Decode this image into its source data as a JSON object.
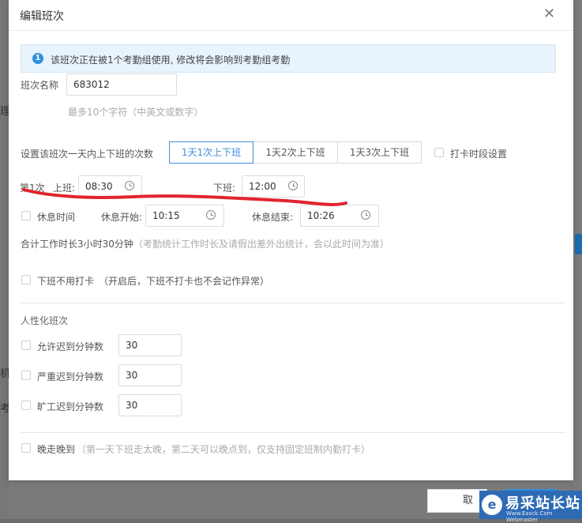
{
  "modal": {
    "title": "编辑班次"
  },
  "notice": {
    "text": "该班次正在被1个考勤组使用, 修改将会影响到考勤组考勤"
  },
  "shift_name": {
    "label": "班次名称",
    "value": "683012",
    "hint": "最多10个字符（中英文或数字）"
  },
  "times_setting": {
    "label": "设置该班次一天内上下班的次数",
    "options": [
      "1天1次上下班",
      "1天2次上下班",
      "1天3次上下班"
    ],
    "selected_index": 0,
    "punch_period_label": "打卡时段设置"
  },
  "first_shift": {
    "label": "第1次",
    "on_label": "上班:",
    "on_value": "08:30",
    "off_label": "下班:",
    "off_value": "12:00"
  },
  "rest": {
    "label": "休息时间",
    "start_label": "休息开始:",
    "start_value": "10:15",
    "end_label": "休息结束:",
    "end_value": "10:26"
  },
  "total": {
    "text": "合计工作时长3小时30分钟",
    "hint": "（考勤统计工作时长及请假出差外出统计，会以此时间为准）"
  },
  "no_punch_off": {
    "label": "下班不用打卡",
    "hint": "（开启后，下班不打卡也不会记作异常）"
  },
  "humanized": {
    "heading": "人性化班次",
    "rows": [
      {
        "label": "允许迟到分钟数",
        "value": "30"
      },
      {
        "label": "严重迟到分钟数",
        "value": "30"
      },
      {
        "label": "旷工迟到分钟数",
        "value": "30"
      }
    ]
  },
  "late_leave": {
    "label": "晚走晚到",
    "hint": "（第一天下班走太晚，第二天可以晚点到，仅支持固定班制内勤打卡）"
  },
  "footer": {
    "cancel_label": "取"
  },
  "background": {
    "chars": [
      "理",
      "机",
      "考"
    ]
  },
  "watermark": {
    "text": "易采站长站",
    "url": "Www.Easck.Com Webmaster"
  },
  "colors": {
    "accent": "#3d8fe0",
    "annotation": "#e0242f"
  }
}
